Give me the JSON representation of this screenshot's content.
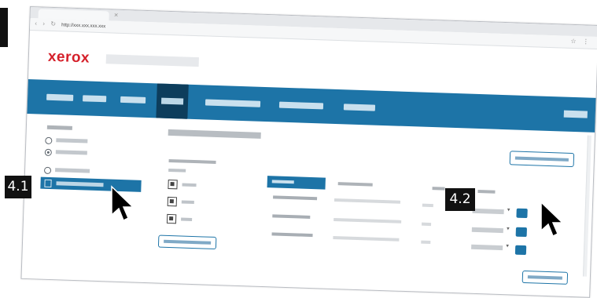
{
  "callouts": [
    {
      "id": "step-4-1",
      "label": "4.1"
    },
    {
      "id": "step-4-2",
      "label": "4.2"
    }
  ],
  "browser": {
    "url": "http://xxx.xxx.xxx.xxx"
  },
  "app": {
    "logo": "xerox"
  },
  "icons": [
    "cursor-arrow-icon",
    "radio-icon",
    "file-icon",
    "chevron-down-icon",
    "close-icon"
  ],
  "colors": {
    "brand_red": "#d5202a",
    "nav_blue": "#1d74a7",
    "nav_active": "#0d3d5c",
    "marker_black": "#111111"
  }
}
